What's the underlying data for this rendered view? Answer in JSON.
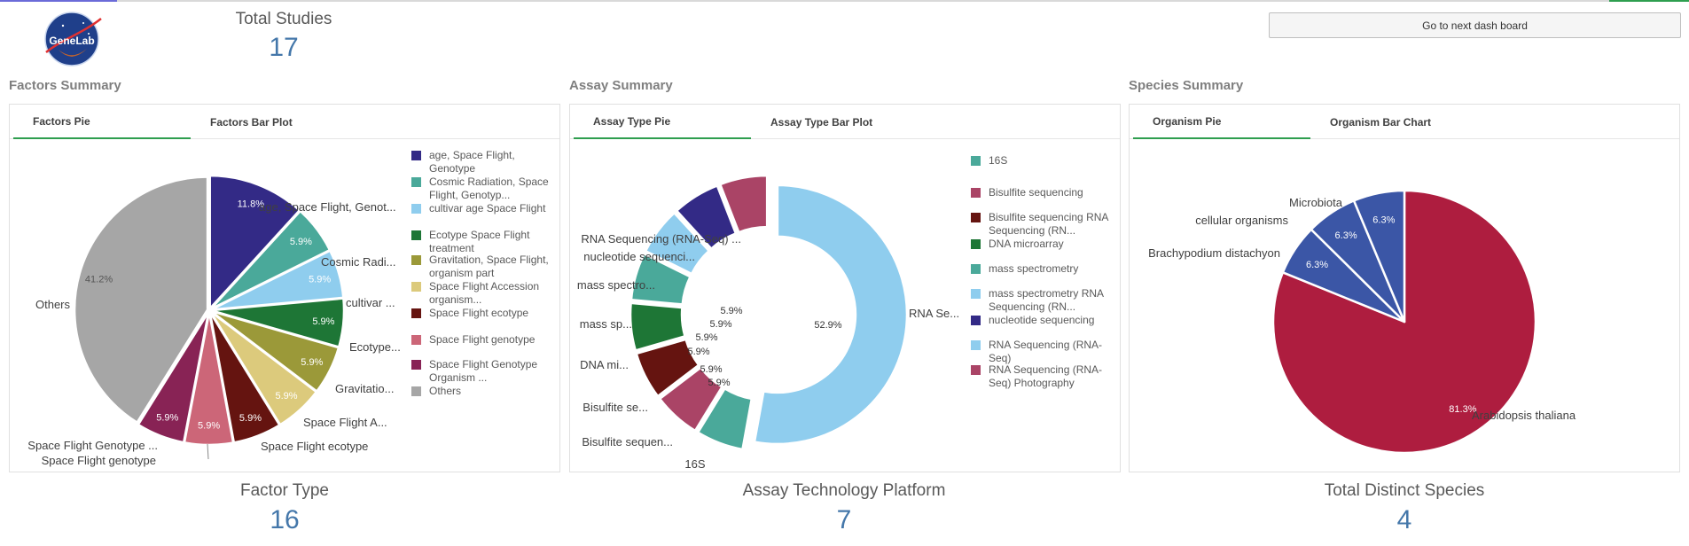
{
  "top": {
    "logo_text": "GeneLab",
    "total_studies_title": "Total Studies",
    "total_studies_value": "17",
    "next_button": "Go to next dash board"
  },
  "bottom": {
    "factor_type_title": "Factor Type",
    "factor_type_value": "16",
    "assay_platform_title": "Assay Technology Platform",
    "assay_platform_value": "7",
    "species_title": "Total Distinct Species",
    "species_value": "4"
  },
  "factors": {
    "section_title": "Factors Summary",
    "tabs": [
      "Factors Pie",
      "Factors Bar Plot"
    ],
    "active_tab": 0
  },
  "assay": {
    "section_title": "Assay Summary",
    "tabs": [
      "Assay Type Pie",
      "Assay Type Bar Plot"
    ],
    "active_tab": 0
  },
  "species": {
    "section_title": "Species Summary",
    "tabs": [
      "Organism Pie",
      "Organism Bar Chart"
    ],
    "active_tab": 0
  },
  "chart_data": [
    {
      "type": "pie",
      "title": "Factors Pie",
      "slices": [
        {
          "outer_label": "age, Space Flight, Genot...",
          "legend": "age, Space Flight, Genotype",
          "value": 11.8,
          "label": "11.8%",
          "color": "#332a86"
        },
        {
          "outer_label": "Cosmic Radi...",
          "legend": "Cosmic Radiation, Space Flight, Genotyp...",
          "value": 5.9,
          "label": "5.9%",
          "color": "#4aa99a"
        },
        {
          "outer_label": "cultivar ...",
          "legend": "cultivar age Space Flight",
          "value": 5.9,
          "label": "5.9%",
          "color": "#8fcdee"
        },
        {
          "outer_label": "Ecotype...",
          "legend": "Ecotype Space Flight treatment",
          "value": 5.9,
          "label": "5.9%",
          "color": "#1e7636"
        },
        {
          "outer_label": "Gravitatio...",
          "legend": "Gravitation, Space Flight, organism part",
          "value": 5.9,
          "label": "5.9%",
          "color": "#9b9939"
        },
        {
          "outer_label": "Space Flight A...",
          "legend": "Space Flight Accession organism...",
          "value": 5.9,
          "label": "5.9%",
          "color": "#dcca7c"
        },
        {
          "outer_label": "Space Flight ecotype",
          "legend": "Space Flight ecotype",
          "value": 5.9,
          "label": "5.9%",
          "color": "#651410"
        },
        {
          "outer_label": "Space Flight genotype",
          "legend": "Space Flight genotype",
          "value": 5.9,
          "label": "5.9%",
          "color": "#cc6678"
        },
        {
          "outer_label": "Space Flight Genotype ...",
          "legend": "Space Flight Genotype Organism ...",
          "value": 5.9,
          "label": "5.9%",
          "color": "#882355"
        },
        {
          "outer_label": "Others",
          "legend": "Others",
          "value": 41.2,
          "label": "41.2%",
          "color": "#a6a6a6"
        }
      ]
    },
    {
      "type": "pie",
      "title": "Assay Type Pie",
      "donut": true,
      "slices": [
        {
          "outer_label": "RNA Se...",
          "value": 52.9,
          "label": "52.9%",
          "color": "#8fcdee"
        },
        {
          "outer_label": "16S",
          "value": 5.9,
          "label": "",
          "color": "#4aa99a"
        },
        {
          "outer_label": "Bisulfite sequen...",
          "value": 5.9,
          "label": "5.9%",
          "color": "#aa4466"
        },
        {
          "outer_label": "Bisulfite se...",
          "value": 5.9,
          "label": "5.9%",
          "color": "#651410"
        },
        {
          "outer_label": "DNA mi...",
          "value": 5.9,
          "label": "5.9%",
          "color": "#1e7636"
        },
        {
          "outer_label": "mass sp...",
          "value": 5.9,
          "label": "5.9%",
          "color": "#4aa99a"
        },
        {
          "outer_label": "mass spectro...",
          "value": 5.9,
          "label": "5.9%",
          "color": "#8fcdee"
        },
        {
          "outer_label": "nucleotide sequenci...",
          "value": 5.9,
          "label": "5.9%",
          "color": "#332a86"
        },
        {
          "outer_label": "RNA Sequencing (RNA-Seq) ...",
          "value": 5.9,
          "label": "",
          "color": "#aa4466"
        }
      ],
      "legend": [
        {
          "text": "16S",
          "color": "#4aa99a"
        },
        {
          "text": "Bisulfite sequencing",
          "color": "#aa4466"
        },
        {
          "text": "Bisulfite sequencing RNA Sequencing (RN...",
          "color": "#651410"
        },
        {
          "text": "DNA microarray",
          "color": "#1e7636"
        },
        {
          "text": "mass spectrometry",
          "color": "#4aa99a"
        },
        {
          "text": "mass spectrometry RNA Sequencing (RN...",
          "color": "#8fcdee"
        },
        {
          "text": "nucleotide sequencing",
          "color": "#332a86"
        },
        {
          "text": "RNA Sequencing (RNA-Seq)",
          "color": "#8fcdee"
        },
        {
          "text": "RNA Sequencing (RNA-Seq) Photography",
          "color": "#aa4466"
        }
      ]
    },
    {
      "type": "pie",
      "title": "Organism Pie",
      "slices": [
        {
          "outer_label": "Arabidopsis thaliana",
          "value": 81.3,
          "label": "81.3%",
          "color": "#ae1d3f"
        },
        {
          "outer_label": "Brachypodium distachyon",
          "value": 6.3,
          "label": "6.3%",
          "color": "#3b56a6"
        },
        {
          "outer_label": "cellular organisms",
          "value": 6.3,
          "label": "6.3%",
          "color": "#3b56a6"
        },
        {
          "outer_label": "Microbiota",
          "value": 6.3,
          "label": "6.3%",
          "color": "#3b56a6"
        }
      ]
    }
  ]
}
